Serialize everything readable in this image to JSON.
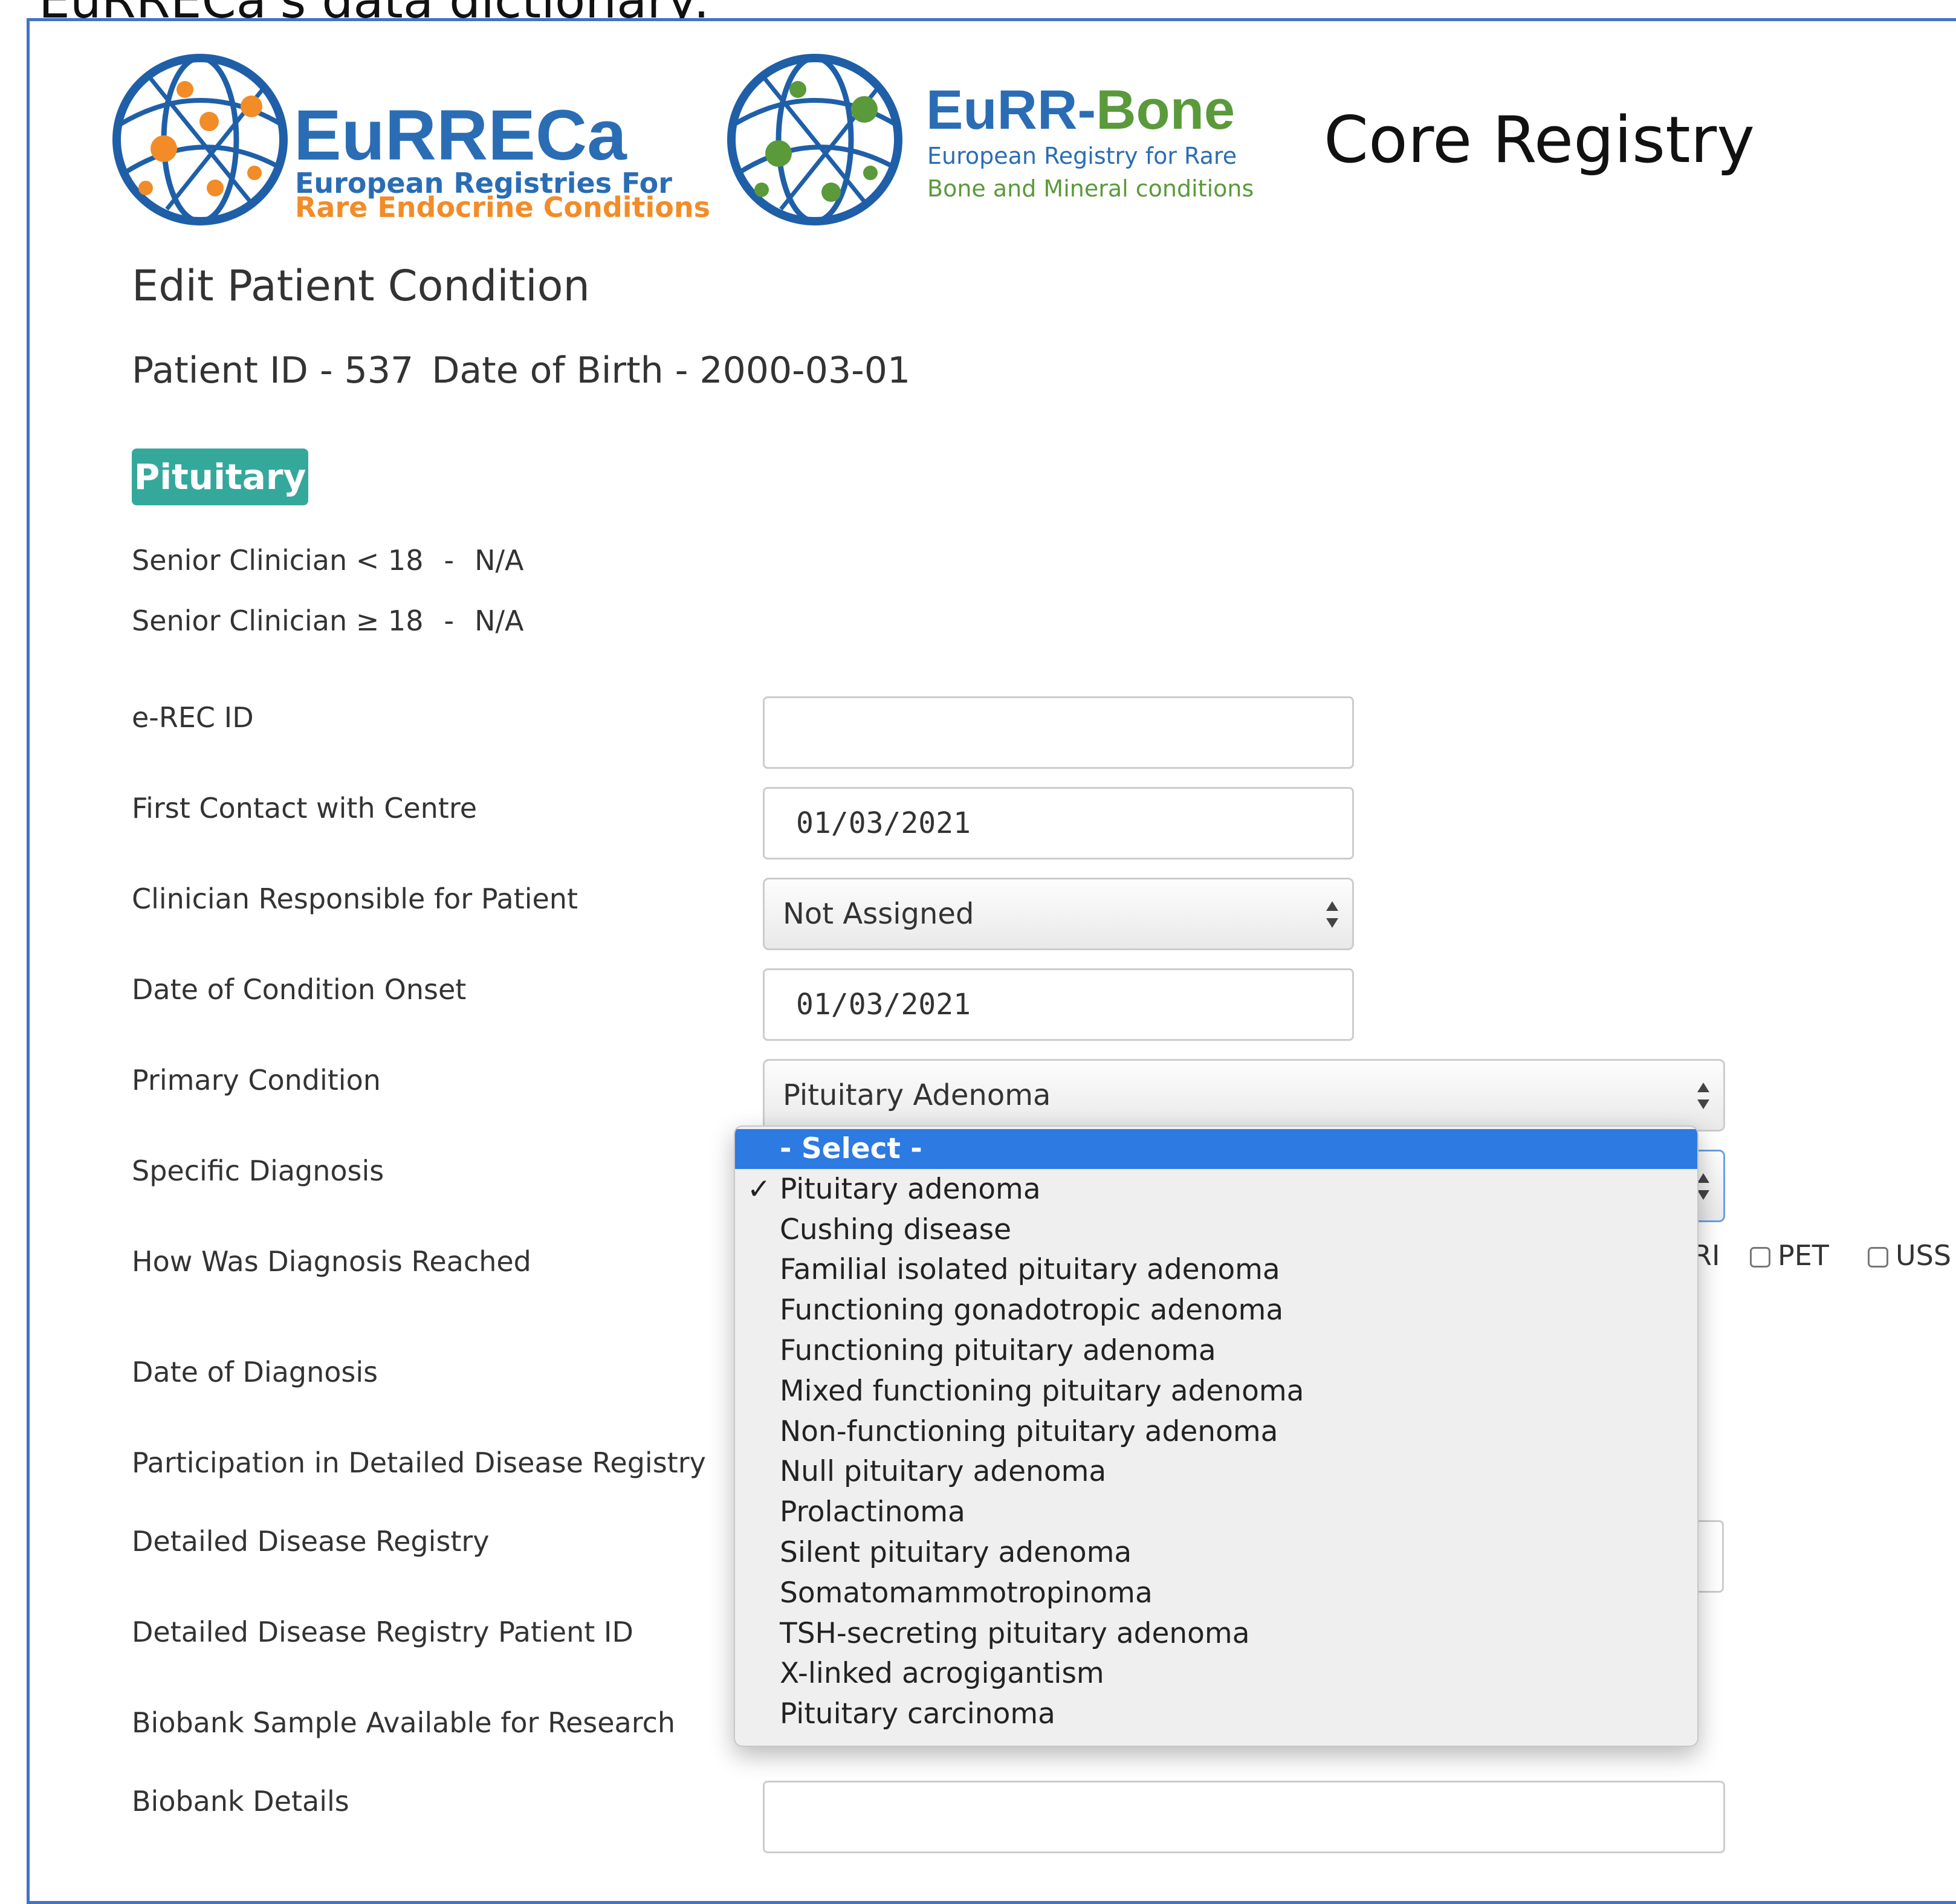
{
  "caption": "EuRRECa's data dictionary:",
  "logos": {
    "eurreca": {
      "title": "EuRRECa",
      "subtitle_line1": "European Registries For",
      "subtitle_line2": "Rare Endocrine Conditions",
      "title_color": "#2a6db5",
      "subtitle_color": "#2a6db5",
      "accent_color": "#f28c28",
      "globe_color": "#1f5fa8"
    },
    "eurrbone": {
      "title_part1": "EuRR-",
      "title_part2": "Bone",
      "subtitle_line1": "European Registry for Rare",
      "subtitle_line2": "Bone and Mineral conditions",
      "title_color": "#2a6db5",
      "accent_color": "#5a9a3a",
      "globe_color": "#1f5fa8"
    }
  },
  "header": {
    "registry_title": "Core Registry"
  },
  "page": {
    "heading": "Edit Patient Condition",
    "patient_id": "Patient ID - 537",
    "date_of_birth": "Date of Birth - 2000-03-01"
  },
  "badge": {
    "label": "Pituitary",
    "color": "#35a89c"
  },
  "clinicians": {
    "under18_label": "Senior Clinician < 18",
    "under18_value": "N/A",
    "over18_label": "Senior Clinician ≥ 18",
    "over18_value": "N/A",
    "separator": "-"
  },
  "form": {
    "erec_id": {
      "label": "e-REC ID",
      "value": ""
    },
    "first_contact": {
      "label": "First Contact with Centre",
      "value": "01/03/2021"
    },
    "clinician": {
      "label": "Clinician Responsible for Patient",
      "value": "Not Assigned"
    },
    "onset": {
      "label": "Date of Condition Onset",
      "value": "01/03/2021"
    },
    "primary_condition": {
      "label": "Primary Condition",
      "value": "Pituitary Adenoma"
    },
    "specific_diagnosis": {
      "label": "Specific Diagnosis"
    },
    "how_reached": {
      "label": "How Was Diagnosis Reached",
      "partial_visible": "RI",
      "options": [
        "PET",
        "USS"
      ]
    },
    "date_of_diagnosis": {
      "label": "Date of Diagnosis"
    },
    "participation": {
      "label": "Participation in Detailed Disease Registry"
    },
    "detailed_registry": {
      "label": "Detailed Disease Registry"
    },
    "detailed_registry_pid": {
      "label": "Detailed Disease Registry Patient ID"
    },
    "biobank_available": {
      "label": "Biobank Sample Available for Research"
    },
    "biobank_details": {
      "label": "Biobank Details",
      "value": ""
    }
  },
  "dropdown": {
    "check_glyph": "✓",
    "selected_highlight": "#2c7ae2",
    "items": [
      {
        "label": "- Select -",
        "highlighted": true,
        "checked": false
      },
      {
        "label": "Pituitary adenoma",
        "highlighted": false,
        "checked": true
      },
      {
        "label": "Cushing disease",
        "highlighted": false,
        "checked": false
      },
      {
        "label": "Familial isolated pituitary adenoma",
        "highlighted": false,
        "checked": false
      },
      {
        "label": "Functioning gonadotropic adenoma",
        "highlighted": false,
        "checked": false
      },
      {
        "label": "Functioning pituitary adenoma",
        "highlighted": false,
        "checked": false
      },
      {
        "label": "Mixed functioning pituitary adenoma",
        "highlighted": false,
        "checked": false
      },
      {
        "label": "Non-functioning pituitary adenoma",
        "highlighted": false,
        "checked": false
      },
      {
        "label": "Null pituitary adenoma",
        "highlighted": false,
        "checked": false
      },
      {
        "label": "Prolactinoma",
        "highlighted": false,
        "checked": false
      },
      {
        "label": "Silent pituitary adenoma",
        "highlighted": false,
        "checked": false
      },
      {
        "label": "Somatomammotropinoma",
        "highlighted": false,
        "checked": false
      },
      {
        "label": "TSH-secreting pituitary adenoma",
        "highlighted": false,
        "checked": false
      },
      {
        "label": "X-linked acrogigantism",
        "highlighted": false,
        "checked": false
      },
      {
        "label": "Pituitary carcinoma",
        "highlighted": false,
        "checked": false
      }
    ]
  }
}
